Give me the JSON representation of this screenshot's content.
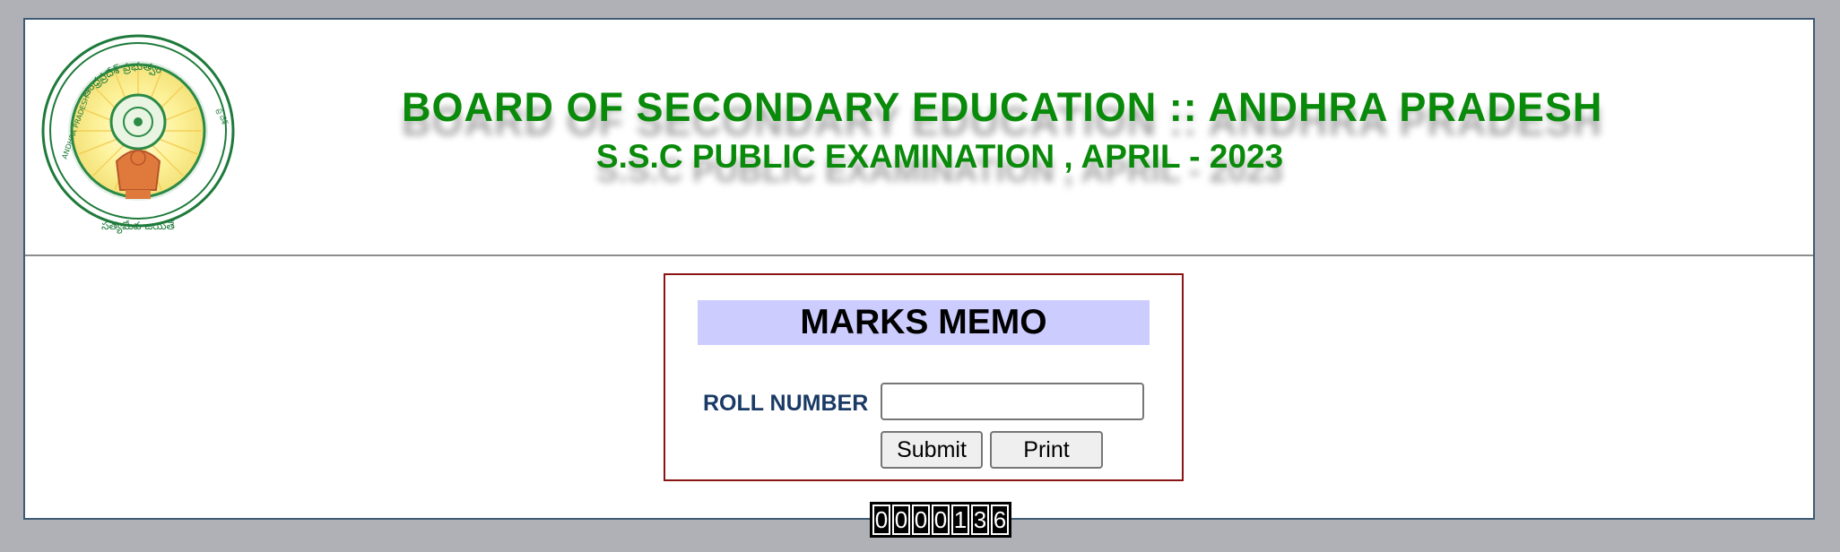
{
  "header": {
    "title_main": "BOARD OF SECONDARY EDUCATION :: ANDHRA PRADESH",
    "title_sub": "S.S.C PUBLIC EXAMINATION , APRIL - 2023",
    "emblem_top_text": "ఆంధ్రప్రదేశ్ ప్రభుత్వం",
    "emblem_bottom_text": "సత్యమేవ జయతే",
    "emblem_left_text": "ANDHRA PRADESH",
    "emblem_right_text": "ప్ర దేశ్"
  },
  "memo": {
    "heading": "MARKS MEMO",
    "roll_label": "ROLL NUMBER",
    "roll_value": "",
    "roll_placeholder": "",
    "submit_label": "Submit",
    "print_label": "Print"
  },
  "counter": {
    "digits": [
      "0",
      "0",
      "0",
      "0",
      "1",
      "3",
      "6"
    ]
  },
  "colors": {
    "page_background": "#b0b1b6",
    "title_green": "#0a8a0a",
    "memo_border": "#8b1414",
    "memo_heading_bg": "#ccccff",
    "roll_label": "#1a3a66"
  }
}
